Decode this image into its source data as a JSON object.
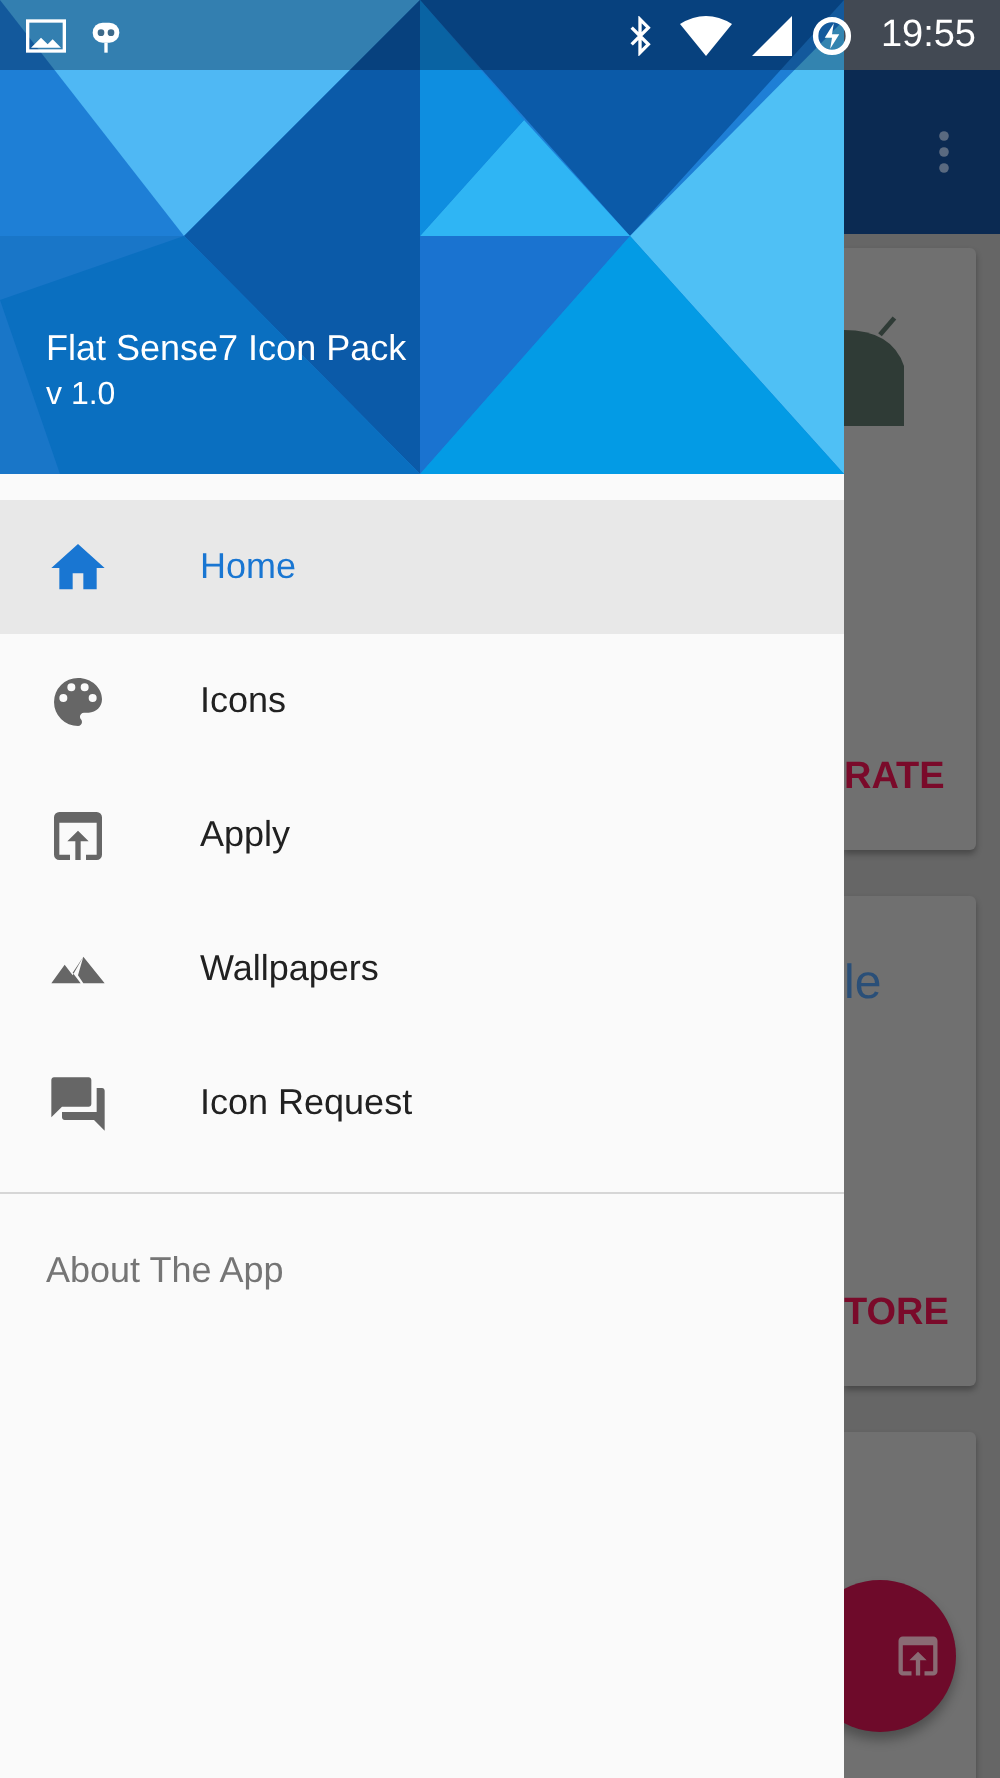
{
  "status_bar": {
    "time": "19:55"
  },
  "drawer": {
    "title": "Flat Sense7 Icon Pack",
    "version": "v 1.0",
    "items": [
      {
        "kind": "home",
        "label": "Home",
        "selected": true
      },
      {
        "kind": "palette",
        "label": "Icons",
        "selected": false
      },
      {
        "kind": "apply",
        "label": "Apply",
        "selected": false
      },
      {
        "kind": "wallpapers",
        "label": "Wallpapers",
        "selected": false
      },
      {
        "kind": "request",
        "label": "Icon Request",
        "selected": false
      }
    ],
    "footer_item": "About The App"
  },
  "background": {
    "cards": [
      {
        "action": "RATE"
      },
      {
        "title": "le",
        "action": "TORE"
      }
    ]
  }
}
